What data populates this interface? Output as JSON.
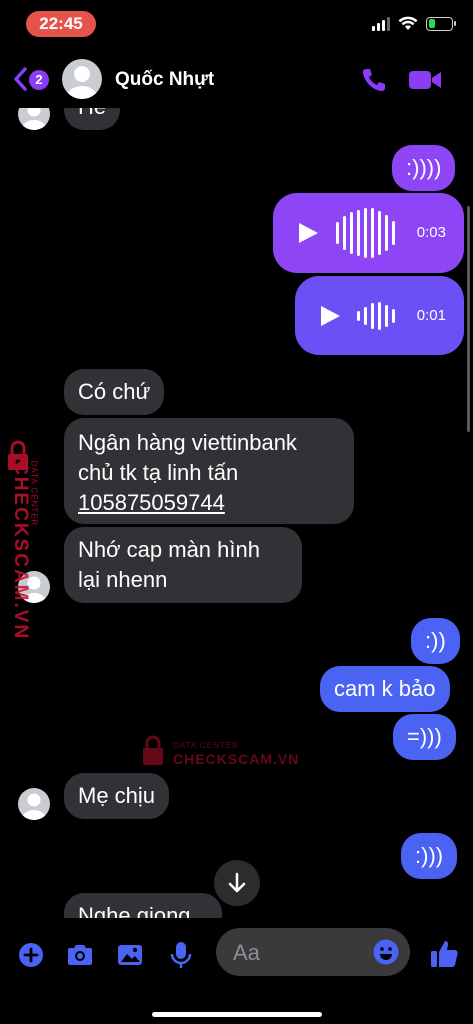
{
  "status_bar": {
    "time": "22:45",
    "battery_level": 0.3
  },
  "header": {
    "back_badge": "2",
    "contact_name": "Quốc Nhựt",
    "accent_color": "#8b3cf6"
  },
  "messages": {
    "m1": "He",
    "m2": ":))))",
    "voice1_duration": "0:03",
    "voice2_duration": "0:01",
    "m3": "Có chứ",
    "m4_line1": "Ngân hàng viettinbank",
    "m4_line2": "chủ tk tạ linh tấn",
    "m4_account": "105875059744",
    "m5_line1": "Nhớ cap màn hình",
    "m5_line2": "lại nhenn",
    "m6": ":))",
    "m7": "cam k bảo",
    "m8": "=)))",
    "m9": "Mẹ  chịu",
    "m10": ":)))",
    "m11": "Nghe giọng"
  },
  "watermark": {
    "brand": "CHECKSCAM.VN",
    "tag": "DATA CENTER"
  },
  "composer": {
    "placeholder": "Aa"
  },
  "icons": [
    "back-icon",
    "phone-icon",
    "video-camera-icon",
    "play-icon",
    "waveform-icon",
    "scroll-down-arrow-icon",
    "add-icon",
    "camera-icon",
    "gallery-icon",
    "microphone-icon",
    "emoji-icon",
    "thumbs-up-icon",
    "lock-icon"
  ]
}
